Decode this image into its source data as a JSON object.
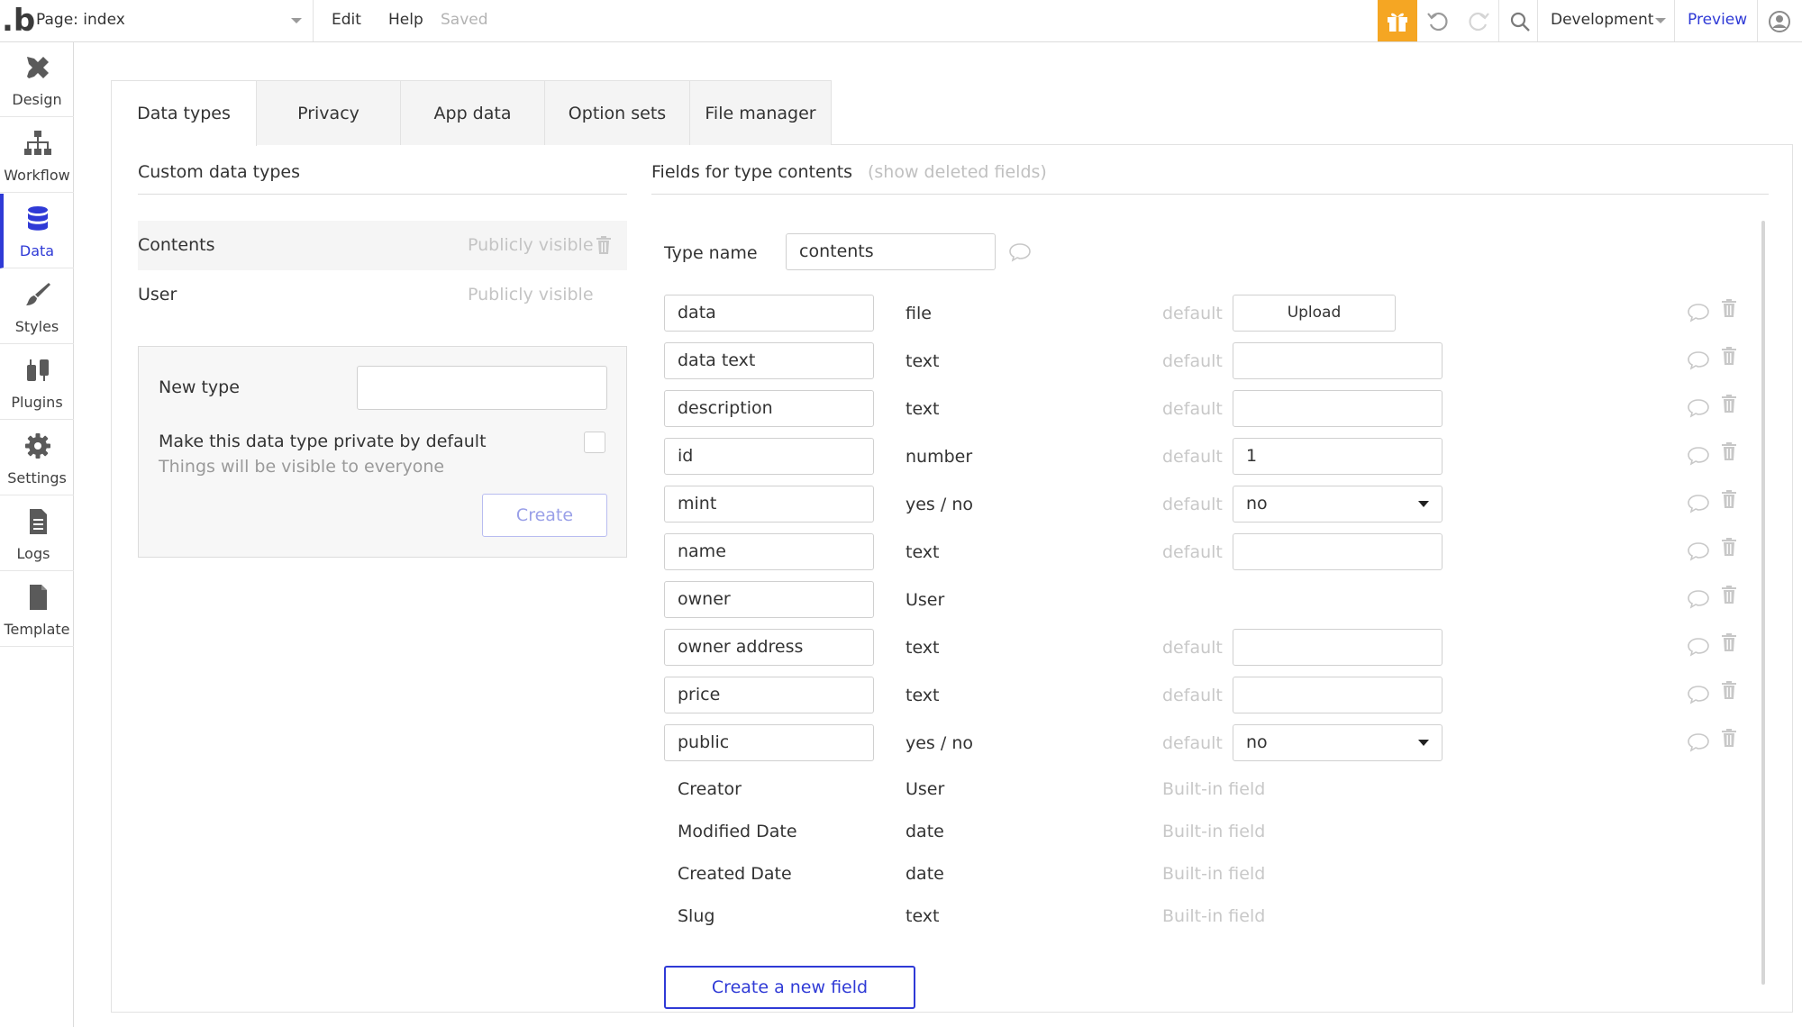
{
  "topbar": {
    "logo": ".b",
    "page_select": "Page: index",
    "menu_edit": "Edit",
    "menu_help": "Help",
    "saved_status": "Saved",
    "environment": "Development",
    "preview": "Preview",
    "accent_color": "#f5a623"
  },
  "sidebar": {
    "items": [
      {
        "label": "Design",
        "icon": "design-icon"
      },
      {
        "label": "Workflow",
        "icon": "workflow-icon"
      },
      {
        "label": "Data",
        "icon": "database-icon",
        "active": true
      },
      {
        "label": "Styles",
        "icon": "brush-icon"
      },
      {
        "label": "Plugins",
        "icon": "plugin-icon"
      },
      {
        "label": "Settings",
        "icon": "gear-icon"
      },
      {
        "label": "Logs",
        "icon": "document-icon"
      },
      {
        "label": "Template",
        "icon": "template-icon"
      }
    ]
  },
  "tabs": [
    "Data types",
    "Privacy",
    "App data",
    "Option sets",
    "File manager"
  ],
  "custom_types": {
    "title": "Custom data types",
    "types": [
      {
        "name": "Contents",
        "visibility": "Publicly visible"
      },
      {
        "name": "User",
        "visibility": "Publicly visible"
      }
    ],
    "new_type_label": "New type",
    "private_label": "Make this data type private by default",
    "private_hint": "Things will be visible to everyone",
    "create_button": "Create"
  },
  "fields_panel": {
    "title": "Fields for type contents",
    "show_deleted": "(show deleted fields)",
    "type_name_label": "Type name",
    "type_name_value": "contents",
    "default_label": "default",
    "upload_label": "Upload",
    "fields": [
      {
        "name": "data",
        "type": "file",
        "default": ""
      },
      {
        "name": "data text",
        "type": "text",
        "default": ""
      },
      {
        "name": "description",
        "type": "text",
        "default": ""
      },
      {
        "name": "id",
        "type": "number",
        "default": "1"
      },
      {
        "name": "mint",
        "type": "yes / no",
        "default": "no"
      },
      {
        "name": "name",
        "type": "text",
        "default": ""
      },
      {
        "name": "owner",
        "type": "User",
        "default": ""
      },
      {
        "name": "owner address",
        "type": "text",
        "default": ""
      },
      {
        "name": "price",
        "type": "text",
        "default": ""
      },
      {
        "name": "public",
        "type": "yes / no",
        "default": "no"
      }
    ],
    "builtin_label": "Built-in field",
    "builtin_fields": [
      {
        "name": "Creator",
        "type": "User"
      },
      {
        "name": "Modified Date",
        "type": "date"
      },
      {
        "name": "Created Date",
        "type": "date"
      },
      {
        "name": "Slug",
        "type": "text"
      }
    ],
    "create_field_button": "Create a new field"
  }
}
